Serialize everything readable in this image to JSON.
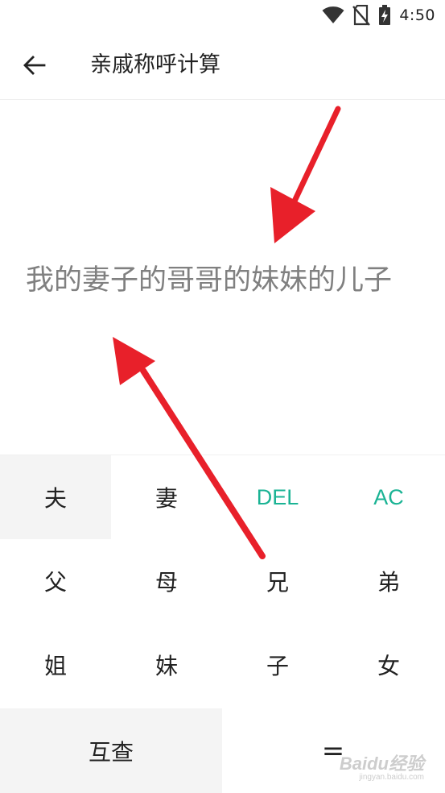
{
  "status_bar": {
    "time": "4:50",
    "icons": [
      "wifi-icon",
      "no-sim-icon",
      "battery-charging-icon"
    ]
  },
  "app_bar": {
    "back_icon": "arrow-left-icon",
    "title": "亲戚称呼计算"
  },
  "display": {
    "expression": "我的妻子的哥哥的妹妹的儿子"
  },
  "keypad": {
    "rows": [
      [
        "夫",
        "妻",
        "DEL",
        "AC"
      ],
      [
        "父",
        "母",
        "兄",
        "弟"
      ],
      [
        "姐",
        "妹",
        "子",
        "女"
      ]
    ],
    "mutual_check": "互查",
    "equals": "="
  },
  "colors": {
    "accent": "#1ab394",
    "annotation_arrow": "#e8202a",
    "expression_text": "#808080"
  },
  "watermark": {
    "main": "Baidu经验",
    "sub": "jingyan.baidu.com"
  }
}
